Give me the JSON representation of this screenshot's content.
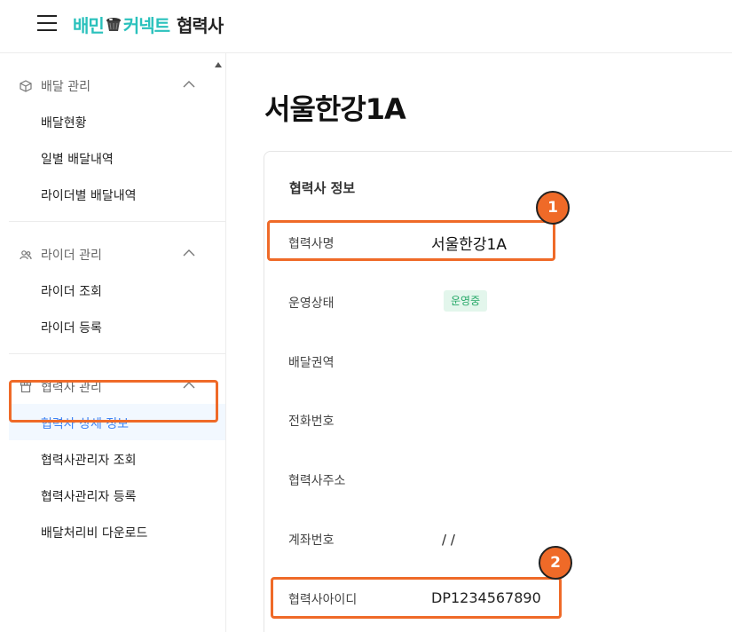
{
  "header": {
    "brand_part1": "배민",
    "brand_part2": "커넥트",
    "brand_sub": "협력사"
  },
  "sidebar": {
    "groups": [
      {
        "title": "배달 관리",
        "icon": "box-icon",
        "items": [
          {
            "label": "배달현황"
          },
          {
            "label": "일별 배달내역"
          },
          {
            "label": "라이더별 배달내역"
          }
        ]
      },
      {
        "title": "라이더 관리",
        "icon": "users-icon",
        "items": [
          {
            "label": "라이더 조회"
          },
          {
            "label": "라이더 등록"
          }
        ]
      },
      {
        "title": "협력사 관리",
        "icon": "store-icon",
        "items": [
          {
            "label": "협력사 상세 정보",
            "active": true
          },
          {
            "label": "협력사관리자 조회"
          },
          {
            "label": "협력사관리자 등록"
          },
          {
            "label": "배달처리비 다운로드"
          }
        ]
      }
    ]
  },
  "main": {
    "page_title": "서울한강1A",
    "card_title": "협력사 정보",
    "rows": [
      {
        "label": "협력사명",
        "value": "서울한강1A"
      },
      {
        "label": "운영상태",
        "value": "운영중"
      },
      {
        "label": "배달권역",
        "value": ""
      },
      {
        "label": "전화번호",
        "value": ""
      },
      {
        "label": "협력사주소",
        "value": ""
      },
      {
        "label": "계좌번호",
        "value": "/ /"
      },
      {
        "label": "협력사아이디",
        "value": "DP1234567890"
      }
    ]
  },
  "annotations": {
    "badge1": "1",
    "badge2": "2"
  },
  "colors": {
    "brand": "#2ac1bc",
    "highlight": "#ef6a28",
    "active_text": "#3b82f6",
    "status_green": "#26a868"
  }
}
